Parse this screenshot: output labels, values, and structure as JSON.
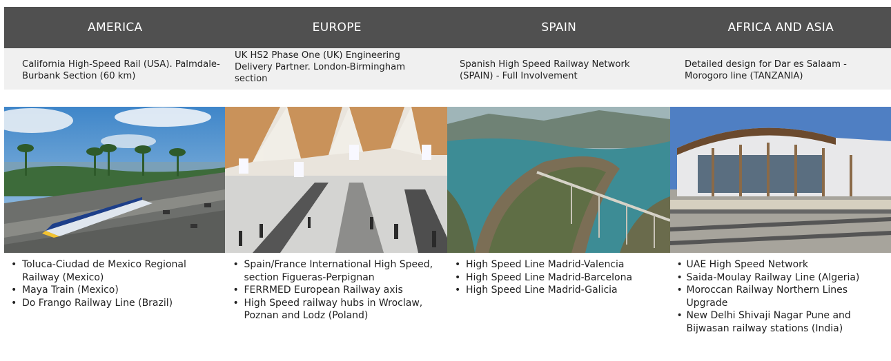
{
  "columns": [
    {
      "title": "AMERICA",
      "project": "California High-Speed Rail (USA). Palmdale-Burbank Section (60 km)",
      "items": [
        "Toluca-Ciudad de Mexico Regional Railway (Mexico)",
        "Maya Train (Mexico)",
        "Do Frango Railway Line (Brazil)"
      ]
    },
    {
      "title": "EUROPE",
      "project": "UK HS2 Phase One (UK) Engineering Delivery Partner. London-Birmingham section",
      "items": [
        "Spain/France International High Speed, section Figueras-Perpignan",
        "FERRMED European Railway axis",
        "High Speed railway hubs in Wroclaw, Poznan and Lodz (Poland)"
      ]
    },
    {
      "title": "SPAIN",
      "project": "Spanish High Speed Railway Network (SPAIN) - Full Involvement",
      "items": [
        "High Speed Line Madrid-Valencia",
        "High Speed Line  Madrid-Barcelona",
        "High Speed Line Madrid-Galicia"
      ]
    },
    {
      "title": "AFRICA AND ASIA",
      "project": "Detailed design for Dar es Salaam - Morogoro line (TANZANIA)",
      "items": [
        "UAE High Speed Network",
        "Saida-Moulay Railway Line (Algeria)",
        "Moroccan Railway Northern Lines Upgrade",
        "New Delhi Shivaji Nagar Pune and Bijwasan railway stations (India)"
      ]
    }
  ],
  "colors": {
    "header_bg": "#505050",
    "header_text": "#ffffff",
    "desc_bg": "#f0f0f0"
  }
}
